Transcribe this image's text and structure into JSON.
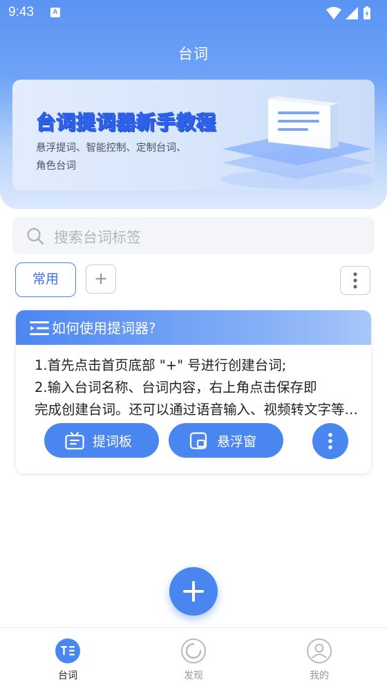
{
  "status_bar": {
    "time": "9:43",
    "notif_letter": "A"
  },
  "header": {
    "title": "台词"
  },
  "banner": {
    "title_part1": "台词提词器",
    "title_part2": "新手",
    "title_part3": "教程",
    "desc_line1": "悬浮提词、智能控制、定制台词、",
    "desc_line2": "角色台词"
  },
  "search": {
    "placeholder": "搜索台词标签"
  },
  "tags": {
    "active_label": "常用",
    "add_label": "+"
  },
  "card": {
    "title": "如何使用提词器?",
    "line1": "1.首先点击首页底部 \"+\" 号进行创建台词;",
    "line2": "2.输入台词名称、台词内容，右上角点击保存即",
    "line3": "完成创建台词。还可以通过语音输入、视频转文字等方式创建台词。",
    "btn_board": "提词板",
    "btn_float": "悬浮窗"
  },
  "bottom_nav": {
    "items": [
      {
        "label": "台词",
        "active": true
      },
      {
        "label": "发现",
        "active": false
      },
      {
        "label": "我的",
        "active": false
      }
    ]
  },
  "colors": {
    "primary": "#4a86f0",
    "header_top": "#5b93f4"
  }
}
